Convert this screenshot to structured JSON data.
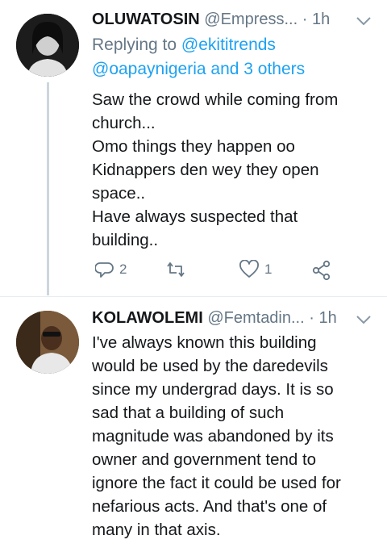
{
  "tweets": [
    {
      "name": "OLUWATOSIN",
      "handle": "@Empress...",
      "separator": "·",
      "time": "1h",
      "reply_prefix": "Replying to",
      "reply_to_1": "@ekititrends",
      "reply_to_2": "@oapaynigeria and 3 others",
      "lines": [
        "Saw the crowd while coming from",
        "church...",
        "Omo things they happen oo",
        "Kidnappers den wey they open",
        "space..",
        "Have always suspected that",
        "building.."
      ],
      "replies": "2",
      "retweets": "",
      "likes": "1",
      "icons": [
        "reply-icon",
        "retweet-icon",
        "like-icon",
        "share-icon"
      ]
    },
    {
      "name": "KOLAWOLEMI",
      "handle": "@Femtadin...",
      "separator": "·",
      "time": "1h",
      "lines": [
        "I've always known this building",
        "would be used by the daredevils",
        "since my undergrad days. It is so",
        "sad that a building of such",
        "magnitude was abandoned by its",
        "owner and government tend to",
        "ignore the fact it could be used for",
        "nefarious acts. And that's one of",
        "many in that axis."
      ]
    }
  ],
  "colors": {
    "accent": "#1da1f2",
    "muted": "#657786",
    "text": "#14171a",
    "thread": "#ccd6dd"
  }
}
